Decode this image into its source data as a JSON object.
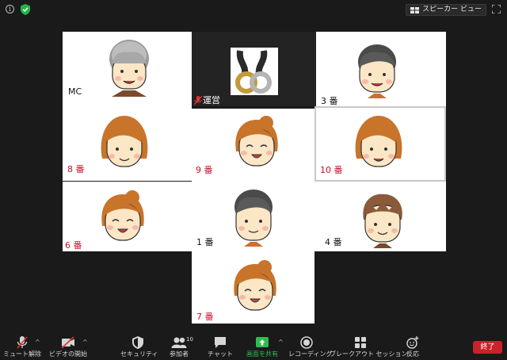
{
  "topbar": {
    "view_label": "スピーカー ビュー",
    "icons": [
      "info-icon",
      "shield-check-icon",
      "gallery-grid-icon",
      "fullscreen-icon"
    ]
  },
  "participants": {
    "mc": "MC",
    "host": "運営",
    "p3": "3 番",
    "p8": "8 番",
    "p9": "9 番",
    "p10": "10 番",
    "p6": "6 番",
    "p1": "1 番",
    "p4": "4 番",
    "p7": "7 番"
  },
  "colors": {
    "background": "#1a1a1a",
    "label_red": "#c8102e",
    "share_green": "#2dbd4e",
    "end_red": "#c8222a"
  },
  "toolbar": {
    "unmute": "ミュート解除",
    "start_video": "ビデオの開始",
    "security": "セキュリティ",
    "participants": "参加者",
    "participants_count": "10",
    "chat": "チャット",
    "share": "画面を共有",
    "record": "レコーディング",
    "breakout": "ブレークアウト セッション",
    "reactions": "反応",
    "end": "終了"
  }
}
